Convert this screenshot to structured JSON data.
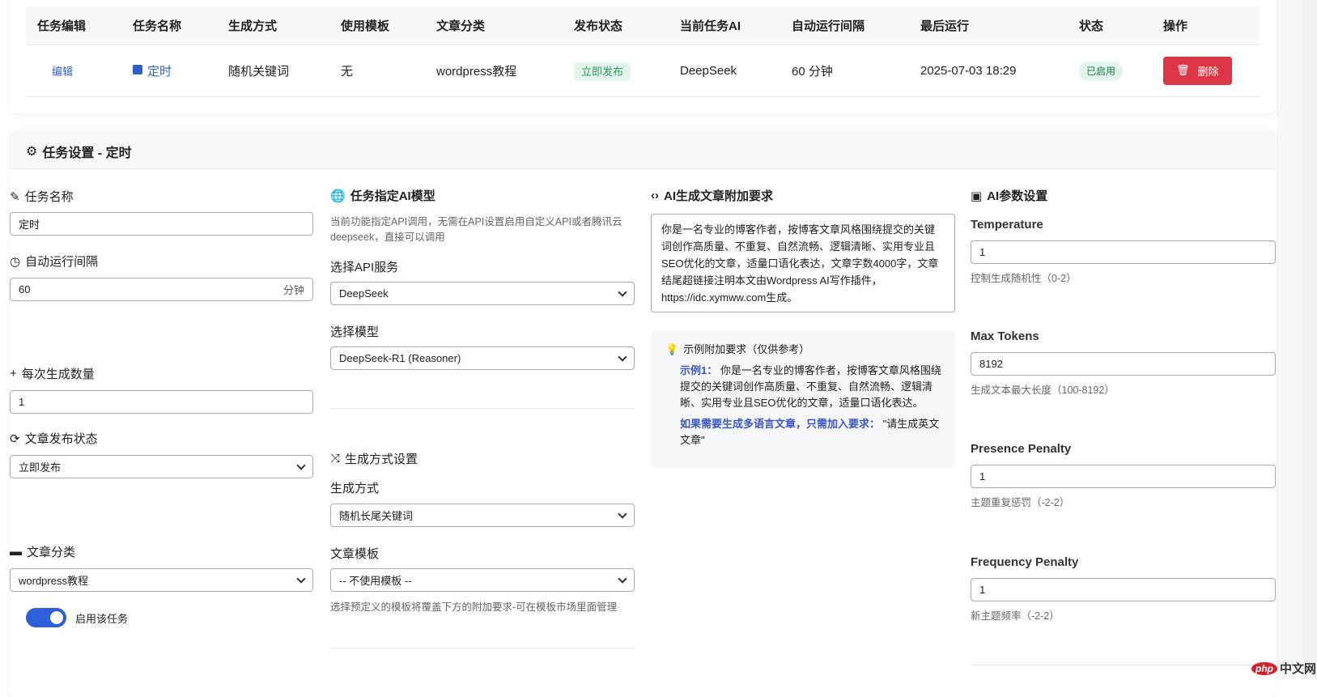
{
  "table": {
    "headers": [
      "任务编辑",
      "任务名称",
      "生成方式",
      "使用模板",
      "文章分类",
      "发布状态",
      "当前任务AI",
      "自动运行间隔",
      "最后运行",
      "状态",
      "操作"
    ],
    "row": {
      "edit": "编辑",
      "name": "定时",
      "method": "随机关键词",
      "template": "无",
      "category": "wordpress教程",
      "publish": "立即发布",
      "ai": "DeepSeek",
      "interval": "60 分钟",
      "last_run": "2025-07-03 18:29",
      "status": "已启用",
      "delete": "删除"
    }
  },
  "settings": {
    "title": "任务设置 - 定时",
    "col1": {
      "name_label": "任务名称",
      "name_value": "定时",
      "interval_label": "自动运行间隔",
      "interval_value": "60",
      "interval_unit": "分钟",
      "count_label": "每次生成数量",
      "count_value": "1",
      "publish_label": "文章发布状态",
      "publish_value": "立即发布",
      "category_label": "文章分类",
      "category_value": "wordpress教程",
      "toggle_label": "启用该任务",
      "toggle_on": true
    },
    "col2": {
      "title": "任务指定AI模型",
      "desc": "当前功能指定API调用，无需在API设置启用自定义API或者腾讯云deepseek，直接可以调用",
      "api_label": "选择API服务",
      "api_value": "DeepSeek",
      "model_label": "选择模型",
      "model_value": "DeepSeek-R1 (Reasoner)",
      "gen_title": "生成方式设置",
      "gen_label": "生成方式",
      "gen_value": "随机长尾关键词",
      "tpl_label": "文章模板",
      "tpl_value": "-- 不使用模板 --",
      "tpl_help": "选择预定义的模板将覆盖下方的附加要求-可在模板市场里面管理"
    },
    "col3": {
      "title": "AI生成文章附加要求",
      "text": "你是一名专业的博客作者，按博客文章风格围绕提交的关键词创作高质量、不重复、自然流畅、逻辑清晰、实用专业且SEO优化的文章，适量口语化表达，文章字数4000字，文章结尾超链接注明本文由Wordpress AI写作插件，https://idc.xymww.com生成。",
      "example_title": "示例附加要求（仅供参考）",
      "example1_label": "示例1：",
      "example1_text": "你是一名专业的博客作者，按博客文章风格围绕提交的关键词创作高质量、不重复、自然流畅、逻辑清晰、实用专业且SEO优化的文章，适量口语化表达。",
      "multi_label": "如果需要生成多语言文章，只需加入要求：",
      "multi_text": "\"请生成英文文章\""
    },
    "col4": {
      "title": "AI参数设置",
      "params": [
        {
          "label": "Temperature",
          "value": "1",
          "help": "控制生成随机性（0-2）"
        },
        {
          "label": "Max Tokens",
          "value": "8192",
          "help": "生成文本最大长度（100-8192）"
        },
        {
          "label": "Presence Penalty",
          "value": "1",
          "help": "主题重复惩罚（-2-2）"
        },
        {
          "label": "Frequency Penalty",
          "value": "1",
          "help": "新主题频率（-2-2）"
        }
      ]
    }
  },
  "watermark": "php中文网",
  "colors": {
    "primary": "#2d5fc4",
    "danger": "#dc3545",
    "success": "#2d9b5f"
  }
}
